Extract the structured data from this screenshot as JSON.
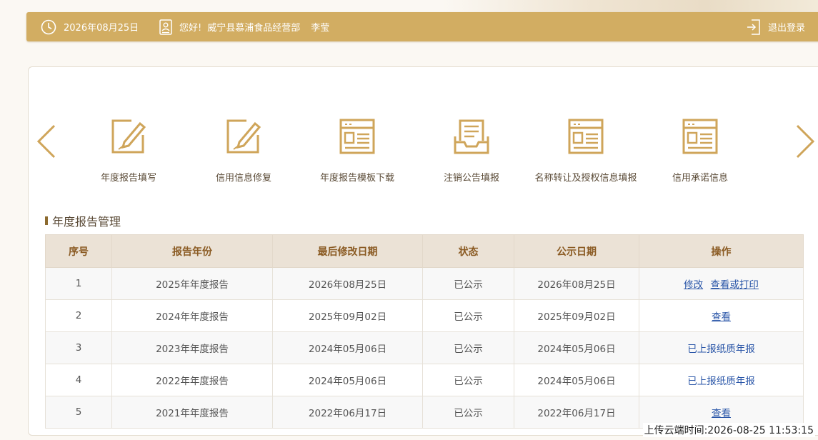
{
  "header": {
    "date": "2026年08月25日",
    "greeting": "您好!",
    "company": "威宁县慕浦食品经营部",
    "user_name": "李莹",
    "logout_label": "退出登录"
  },
  "functions": [
    {
      "label": "年度报告填写",
      "icon": "edit-icon"
    },
    {
      "label": "信用信息修复",
      "icon": "edit-icon"
    },
    {
      "label": "年度报告模板下载",
      "icon": "document-icon"
    },
    {
      "label": "注销公告填报",
      "icon": "inbox-icon"
    },
    {
      "label": "名称转让及授权信息填报",
      "icon": "document-icon"
    },
    {
      "label": "信用承诺信息",
      "icon": "document-icon"
    }
  ],
  "section": {
    "title": "年度报告管理"
  },
  "table": {
    "headers": [
      "序号",
      "报告年份",
      "最后修改日期",
      "状态",
      "公示日期",
      "操作"
    ],
    "rows": [
      {
        "no": "1",
        "year": "2025年年度报告",
        "modified": "2026年08月25日",
        "status": "已公示",
        "publish": "2026年08月25日",
        "op1": "修改",
        "op2": "查看或打印"
      },
      {
        "no": "2",
        "year": "2024年年度报告",
        "modified": "2025年09月02日",
        "status": "已公示",
        "publish": "2025年09月02日",
        "op1": "查看"
      },
      {
        "no": "3",
        "year": "2023年年度报告",
        "modified": "2024年05月06日",
        "status": "已公示",
        "publish": "2024年05月06日",
        "op_text": "已上报纸质年报"
      },
      {
        "no": "4",
        "year": "2022年年度报告",
        "modified": "2024年05月06日",
        "status": "已公示",
        "publish": "2024年05月06日",
        "op_text": "已上报纸质年报"
      },
      {
        "no": "5",
        "year": "2021年年度报告",
        "modified": "2022年06月17日",
        "status": "已公示",
        "publish": "2022年06月17日",
        "op1": "查看"
      }
    ]
  },
  "footer": {
    "timestamp": "上传云端时间:2026-08-25 11:53:15"
  },
  "colors": {
    "accent": "#d2ad62",
    "icon": "#cfa55a",
    "link": "#2a56a8",
    "header_bg": "#ebe2d6"
  }
}
